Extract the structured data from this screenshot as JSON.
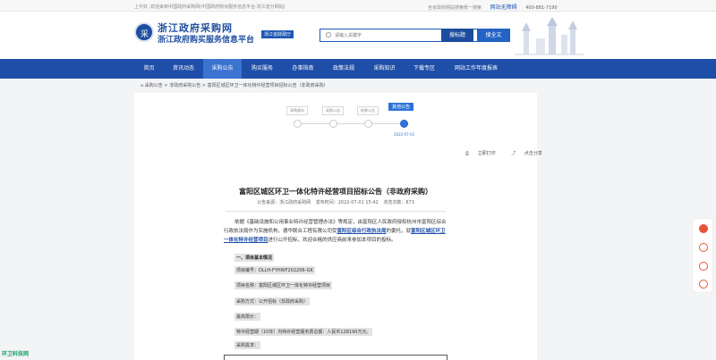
{
  "topbar": {
    "welcome": "上午好 ,欢迎来到中国政府采购网(中国政府购买服务信息平台·浙江省分网站)",
    "links": [
      "全省政府网站搜索统一搜索",
      "网站无障碍",
      "400-881-7190"
    ]
  },
  "header": {
    "logo_mark": "采",
    "title": "浙江政府采购网",
    "subtitle": "浙江政府购买服务信息平台",
    "region_tag": "浙江省财政厅",
    "search_placeholder": "请输入关键字",
    "search_title_button": "搜标题",
    "search_full_button": "搜全文"
  },
  "nav": {
    "items": [
      "首页",
      "资讯动态",
      "采购公告",
      "购买服务",
      "办事指南",
      "政策法规",
      "采购知识",
      "下载专区",
      "网站工作年度报表"
    ],
    "active_index": 2
  },
  "breadcrumb": {
    "items": [
      "采购公告",
      "非政府采购公告",
      "富阳区城区环卫一体化特许经营项目招标公告（非政府采购）"
    ],
    "separator": ">"
  },
  "flow": {
    "steps": [
      "采购意向",
      "采购公告",
      "结果公告",
      "其他公告"
    ],
    "active_step": 3,
    "active_date": "2022-07-01"
  },
  "tools": {
    "print": "立即打印",
    "share": "点击分享"
  },
  "article": {
    "title": "富阳区城区环卫一体化特许经营项目招标公告（非政府采购）",
    "meta": {
      "source": "公告来源：浙江政府采购网",
      "time": "发布时间：2022-07-01 15:42",
      "views": "浏览次数：673"
    },
    "intro_prefix": "依据《基础设施和公用事业特许经营管理办法》等规定，由富阳区人民政府授权杭州市富阳区综合行政执法局作为实施机构，德华联合工程有限公司受",
    "intro_link1": "富阳区综合行政执法局",
    "intro_middle": "的委托，就",
    "intro_link2": "富阳区城区环卫一体化特许经营项目",
    "intro_suffix": "进行公开招标，欢迎合格的供应商前来参加本项目的投标。",
    "section_heading": "一、项目基本情况",
    "fields": [
      "项目编号：DLLH-FYHWF202206-GK",
      "项目名称：富阳区城区环卫一体化特许经营项目",
      "采购方式：公开招标（非政府采购）",
      "最高限价：",
      "特许经营期（10年）内特许经营服务费总额：人民币128190万元。",
      "采购需求："
    ],
    "amount_highlight": "128190"
  },
  "floating_badge": "环卫科技网"
}
